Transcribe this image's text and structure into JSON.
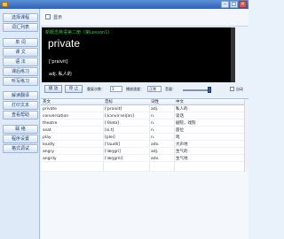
{
  "window": {
    "title": "",
    "minimize": "–",
    "maximize": "□",
    "close": "×"
  },
  "sidebar": {
    "items": [
      {
        "label": "选择课程"
      },
      {
        "label": "词汇列表"
      },
      {
        "label": "单 词"
      },
      {
        "label": "课 文"
      },
      {
        "label": "语 法"
      },
      {
        "label": "课后练习"
      },
      {
        "label": "听写练习"
      },
      {
        "label": "解读翻译"
      },
      {
        "label": "打印文本"
      },
      {
        "label": "查看帮助"
      },
      {
        "label": "联 络"
      },
      {
        "label": "程序设置"
      },
      {
        "label": "格式调试"
      }
    ]
  },
  "topbar": {
    "checkbox_label": "显示"
  },
  "display": {
    "lesson": "新概念英语第二册（第Lesson1）",
    "word": "private",
    "phonetic": "[ˈpraivit]",
    "meaning": "adj. 私人的"
  },
  "controls": {
    "play_label": "播 放",
    "stop_label": "停 止",
    "repeat_label": "重复次数：",
    "repeat_value": "1",
    "speed_label": "播放速度：",
    "speed_value": "正常",
    "volume_label": "音量：",
    "auto_label": "自动"
  },
  "table": {
    "headers": [
      "英文",
      "音标",
      "词性",
      "中文"
    ],
    "rows": [
      [
        "private",
        "[ˈpraivit]",
        "adj.",
        "私人的"
      ],
      [
        "conversation",
        "[ˌkɔnvəˈseiʃən]",
        "n.",
        "谈话"
      ],
      [
        "theatre",
        "[ˈθiətə]",
        "n.",
        "剧院，戏院"
      ],
      [
        "seat",
        "[siːt]",
        "n.",
        "座位"
      ],
      [
        "play",
        "[plei]",
        "n.",
        "戏"
      ],
      [
        "loudly",
        "[ˈlaudli]",
        "adv.",
        "大声地"
      ],
      [
        "angry",
        "[ˈæŋgri]",
        "adj.",
        "生气的"
      ],
      [
        "angrily",
        "[ˈæŋgrili]",
        "adv.",
        "生气地"
      ]
    ]
  },
  "colors": {
    "display_bg": "#000000",
    "lesson_text": "#2fc34f",
    "title_bar": "#2f63b5"
  },
  "icons": [
    "app-icon",
    "minimize-icon",
    "maximize-icon",
    "close-icon",
    "slider-thumb"
  ]
}
